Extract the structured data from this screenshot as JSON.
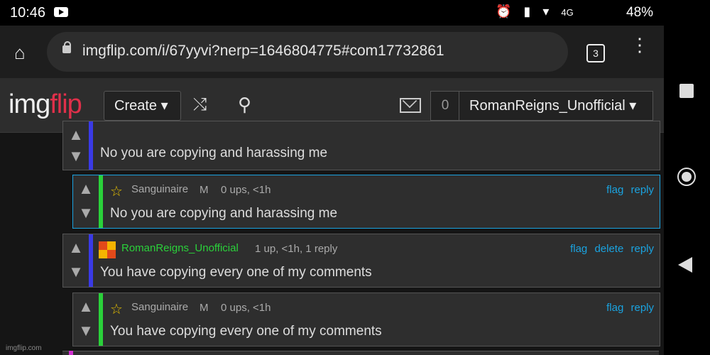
{
  "status_bar": {
    "time": "10:46",
    "network": "4G",
    "battery": "48%"
  },
  "browser": {
    "url": "imgflip.com/i/67yyvi?nerp=1646804775#com17732861",
    "tab_count": "3"
  },
  "site_header": {
    "logo_a": "img",
    "logo_b": "flip",
    "create_label": "Create ▾",
    "notif_count": "0",
    "username": "RomanReigns_Unofficial ▾"
  },
  "comments": [
    {
      "text": "No you are copying and harassing me",
      "bar_color": "#3a3ae6"
    },
    {
      "user": "Sanguinaire",
      "badge": "M",
      "meta": "0 ups, <1h",
      "actions": [
        "flag",
        "reply"
      ],
      "text": "No you are copying and harassing me",
      "bar_color": "#2ad13a"
    },
    {
      "user": "RomanReigns_Unofficial",
      "meta": "1 up, <1h, 1 reply",
      "actions": [
        "flag",
        "delete",
        "reply"
      ],
      "text": "You have copying every one of my comments",
      "bar_color": "#3a3ae6"
    },
    {
      "user": "Sanguinaire",
      "badge": "M",
      "meta": "0 ups, <1h",
      "actions": [
        "flag",
        "reply"
      ],
      "text": "You have copying every one of my comments",
      "bar_color": "#2ad13a"
    }
  ],
  "watermark": "imgflip.com",
  "colors": {
    "link": "#1aa3e0",
    "green_user": "#2ad13a",
    "logo_red": "#e0304a"
  }
}
